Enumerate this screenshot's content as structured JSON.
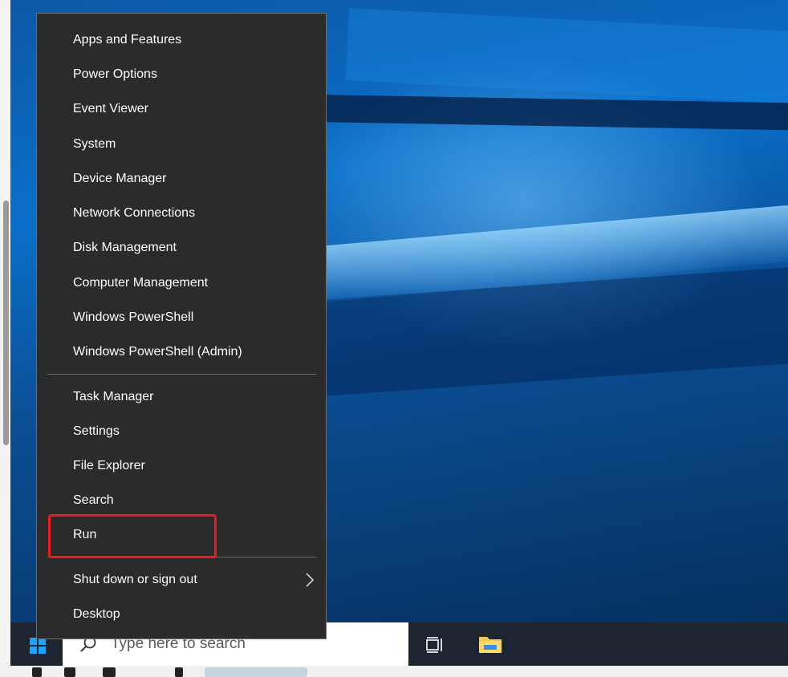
{
  "menu": {
    "group1": [
      {
        "label": "Apps and Features"
      },
      {
        "label": "Power Options"
      },
      {
        "label": "Event Viewer"
      },
      {
        "label": "System"
      },
      {
        "label": "Device Manager"
      },
      {
        "label": "Network Connections"
      },
      {
        "label": "Disk Management"
      },
      {
        "label": "Computer Management"
      },
      {
        "label": "Windows PowerShell"
      },
      {
        "label": "Windows PowerShell (Admin)"
      }
    ],
    "group2": [
      {
        "label": "Task Manager"
      },
      {
        "label": "Settings"
      },
      {
        "label": "File Explorer"
      },
      {
        "label": "Search"
      },
      {
        "label": "Run"
      }
    ],
    "group3": [
      {
        "label": "Shut down or sign out",
        "has_submenu": true
      },
      {
        "label": "Desktop"
      }
    ],
    "highlighted_item": "Run",
    "highlight_color": "#f01c1c"
  },
  "taskbar": {
    "search_placeholder": "Type here to search",
    "icons": [
      "windows-start-icon",
      "search-icon",
      "task-view-icon",
      "file-explorer-icon"
    ]
  },
  "colors": {
    "menu_background": "#2b2b2b",
    "taskbar_background": "#1c2530",
    "accent": "#1aa3ff"
  }
}
